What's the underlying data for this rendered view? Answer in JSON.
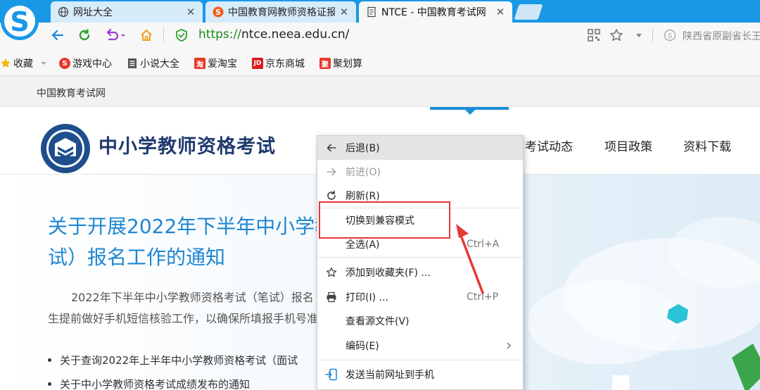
{
  "tabs": [
    {
      "title": "网址大全",
      "icon": "globe-icon",
      "active": false
    },
    {
      "title": "中国教育网教师资格证报",
      "icon": "sogou-icon",
      "active": false
    },
    {
      "title": "NTCE - 中国教育考试网",
      "icon": "page-icon",
      "active": true
    }
  ],
  "address_bar": {
    "scheme": "https://",
    "host": "ntce.neea.edu.cn/"
  },
  "search_hint": "陕西省原副省长王",
  "bookmarks": [
    {
      "label": "收藏",
      "icon": "star-icon"
    },
    {
      "label": "游戏中心",
      "icon": "game-icon"
    },
    {
      "label": "小说大全",
      "icon": "book-icon"
    },
    {
      "label": "爱淘宝",
      "icon": "taobao-icon",
      "glyph": "淘"
    },
    {
      "label": "京东商城",
      "icon": "jd-icon",
      "glyph": "JD"
    },
    {
      "label": "聚划算",
      "icon": "juhuasuan-icon",
      "glyph": "聚"
    }
  ],
  "site": {
    "top_label": "中国教育考试网",
    "title": "中小学教师资格考试",
    "nav": [
      "考试动态",
      "项目政策",
      "资料下载"
    ]
  },
  "notice": {
    "title_line1": "关于开展2022年下半年中小学教",
    "title_line2": "试）报名工作的通知",
    "body_line1": "2022年下半年中小学教师资格考试（笔试）报名",
    "body_line2": "生提前做好手机短信核验工作，以确保所填报手机号准",
    "links": [
      "关于查询2022年上半年中小学教师资格考试（面试",
      "关于中小学教师资格考试成绩发布的通知"
    ]
  },
  "context_menu": {
    "items": [
      {
        "label": "后退(B)",
        "icon": "arrow-left-icon",
        "shortcut": "",
        "state": "hover"
      },
      {
        "label": "前进(O)",
        "icon": "arrow-right-icon",
        "shortcut": "",
        "state": "disabled"
      },
      {
        "label": "刷新(R)",
        "icon": "refresh-icon",
        "shortcut": "",
        "state": "normal"
      },
      {
        "label": "切换到兼容模式",
        "icon": "",
        "shortcut": "",
        "state": "normal"
      },
      {
        "label": "全选(A)",
        "icon": "",
        "shortcut": "Ctrl+A",
        "state": "normal"
      },
      {
        "label": "添加到收藏夹(F) ...",
        "icon": "star-outline-icon",
        "shortcut": "",
        "state": "normal"
      },
      {
        "label": "打印(I) ...",
        "icon": "printer-icon",
        "shortcut": "Ctrl+P",
        "state": "normal"
      },
      {
        "label": "查看源文件(V)",
        "icon": "",
        "shortcut": "",
        "state": "normal"
      },
      {
        "label": "编码(E)",
        "icon": "",
        "shortcut": "",
        "state": "normal",
        "submenu": true
      },
      {
        "label": "发送当前网址到手机",
        "icon": "send-to-phone-icon",
        "shortcut": "",
        "state": "normal"
      }
    ]
  },
  "colors": {
    "tabstrip": "#1a98e8",
    "site_title": "#1f3a6e",
    "notice_title": "#1d86d1",
    "annotation": "#e53935"
  }
}
